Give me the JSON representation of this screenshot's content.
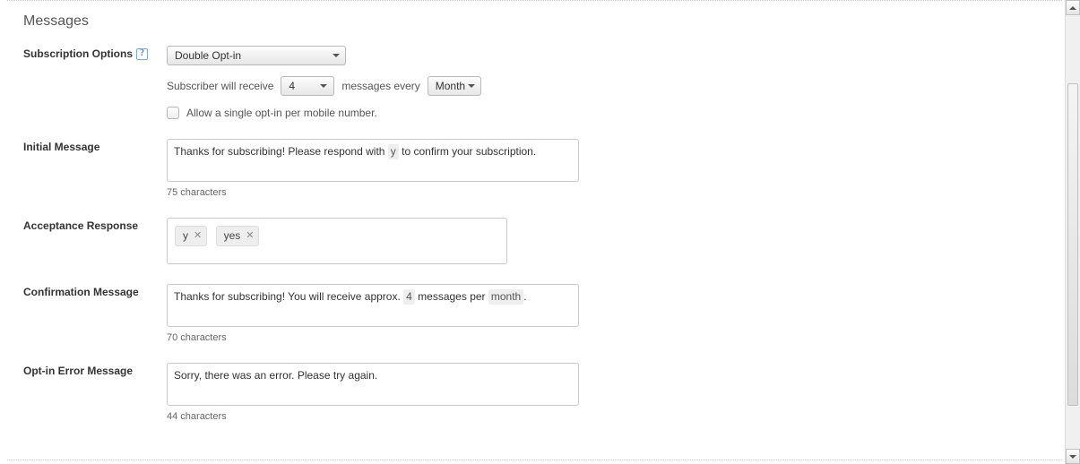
{
  "section_title": "Messages",
  "subscription": {
    "label": "Subscription Options",
    "help_tooltip": "?",
    "dropdown_value": "Double Opt-in",
    "frequency_prefix": "Subscriber will receive",
    "frequency_count": "4",
    "frequency_mid": "messages every",
    "frequency_period": "Month",
    "checkbox_label": "Allow a single opt-in per mobile number."
  },
  "initial_message": {
    "label": "Initial Message",
    "text_before_chip": "Thanks for subscribing! Please respond with ",
    "chip": "y",
    "text_after_chip": " to confirm your subscription.",
    "char_count": "75 characters"
  },
  "acceptance": {
    "label": "Acceptance Response",
    "tags": [
      "y",
      "yes"
    ]
  },
  "confirmation": {
    "label": "Confirmation Message",
    "text_before_chip1": "Thanks for subscribing! You will receive approx. ",
    "chip1": "4",
    "text_mid": " messages per ",
    "chip2": "month",
    "text_after": ".",
    "char_count": "70 characters"
  },
  "error_message": {
    "label": "Opt-in Error Message",
    "text": "Sorry, there was an error. Please try again.",
    "char_count": "44 characters"
  }
}
